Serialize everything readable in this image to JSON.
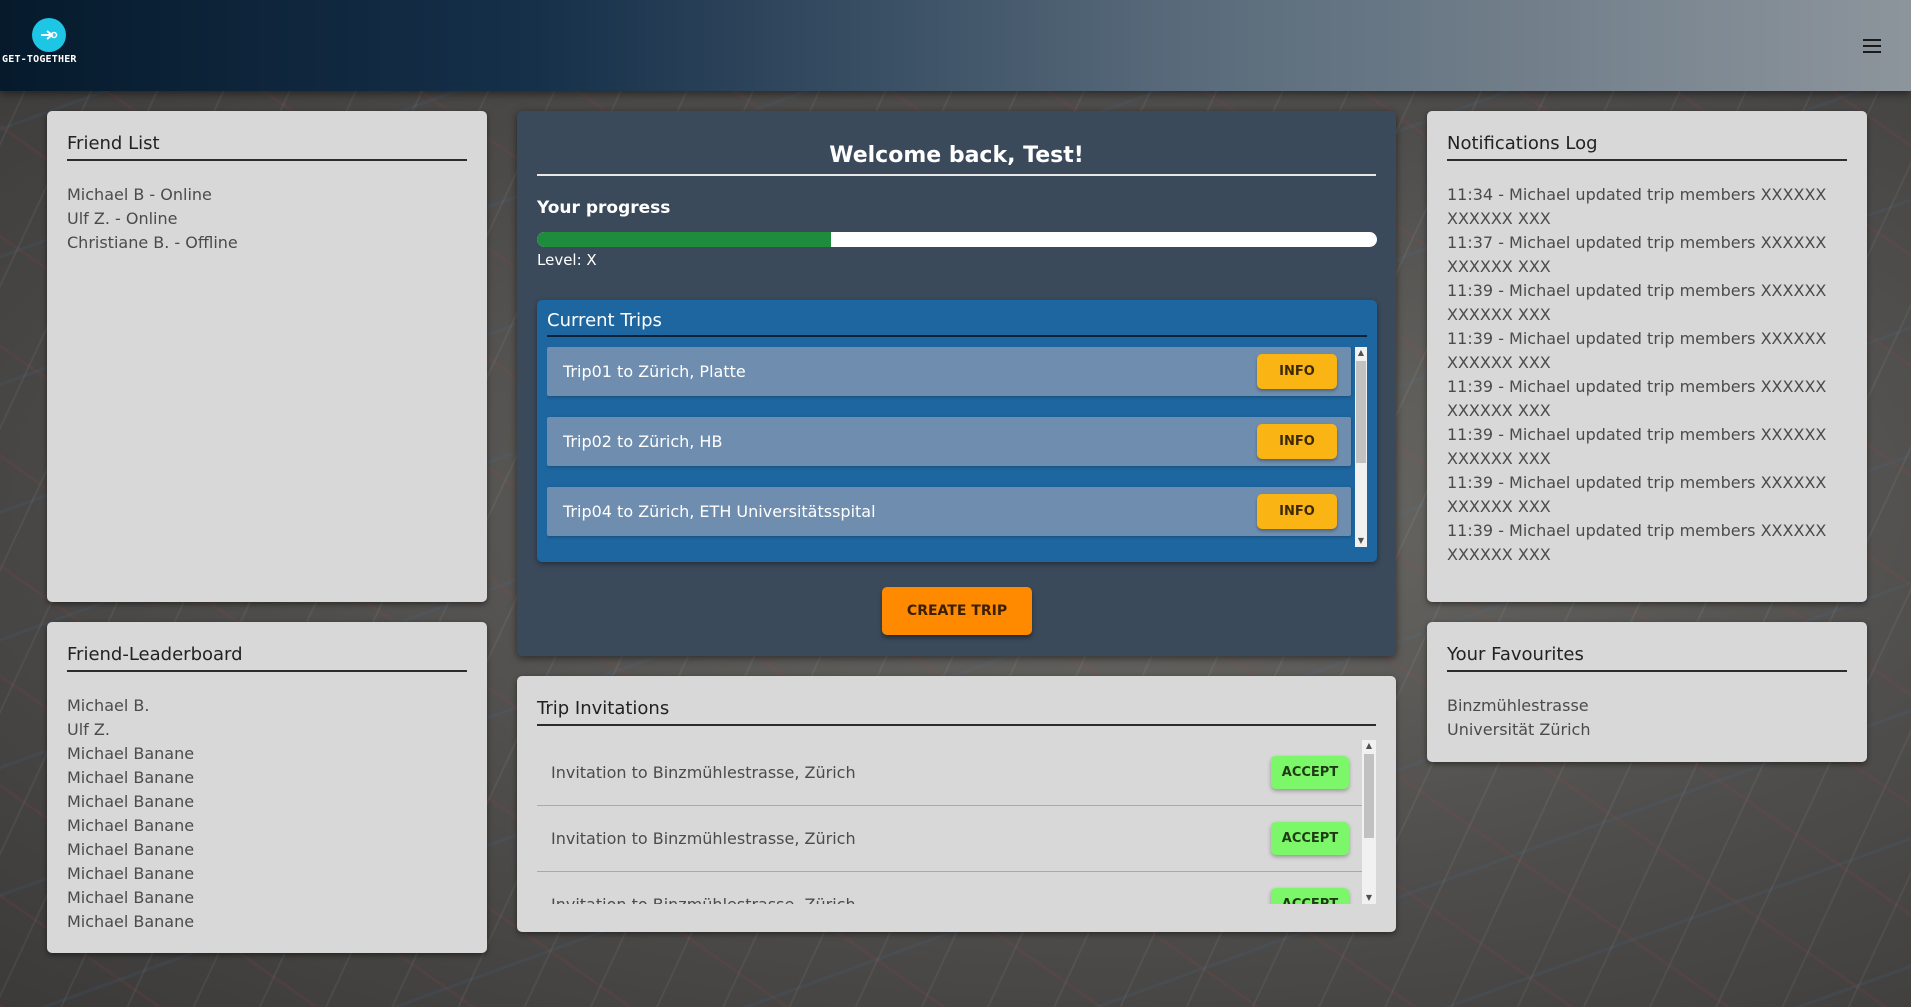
{
  "app": {
    "logo_text": "GET-TOGETHER"
  },
  "header": {
    "menu_icon": "hamburger-menu-icon"
  },
  "colors": {
    "navbar_dark": "#061a2c",
    "progress": "#1e8c3c",
    "trip_panel": "#1e66a0",
    "info_button": "#fab413",
    "create_button": "#ff8a00",
    "accept_button": "#7df76a"
  },
  "friend_list": {
    "title": "Friend List",
    "items": [
      "Michael B - Online",
      "Ulf Z. - Online",
      "Christiane B. - Offline"
    ]
  },
  "leaderboard": {
    "title": "Friend-Leaderboard",
    "items": [
      "Michael B.",
      "Ulf Z.",
      "Michael Banane",
      "Michael Banane",
      "Michael Banane",
      "Michael Banane",
      "Michael Banane",
      "Michael Banane",
      "Michael Banane",
      "Michael Banane"
    ]
  },
  "main": {
    "welcome": "Welcome back, Test!",
    "progress_label": "Your progress",
    "progress_fraction": 0.35,
    "level": "Level: X",
    "trips": {
      "title": "Current Trips",
      "button_label": "INFO",
      "items": [
        "Trip01 to Zürich, Platte",
        "Trip02 to Zürich, HB",
        "Trip04 to Zürich, ETH Universitätsspital"
      ]
    },
    "create_trip_label": "CREATE TRIP"
  },
  "invitations": {
    "title": "Trip Invitations",
    "button_label": "ACCEPT",
    "items": [
      "Invitation to Binzmühlestrasse, Zürich",
      "Invitation to Binzmühlestrasse, Zürich",
      "Invitation to Binzmühlestrasse, Zürich"
    ]
  },
  "notifications": {
    "title": "Notifications Log",
    "items": [
      "11:34 - Michael updated trip members XXXXXX XXXXXX XXX",
      "11:37 - Michael updated trip members XXXXXX XXXXXX XXX",
      "11:39 - Michael updated trip members XXXXXX XXXXXX XXX",
      "11:39 - Michael updated trip members XXXXXX XXXXXX XXX",
      "11:39 - Michael updated trip members XXXXXX XXXXXX XXX",
      "11:39 - Michael updated trip members XXXXXX XXXXXX XXX",
      "11:39 - Michael updated trip members XXXXXX XXXXXX XXX",
      "11:39 - Michael updated trip members XXXXXX XXXXXX XXX"
    ]
  },
  "favourites": {
    "title": "Your Favourites",
    "items": [
      "Binzmühlestrasse",
      "Universität Zürich"
    ]
  }
}
